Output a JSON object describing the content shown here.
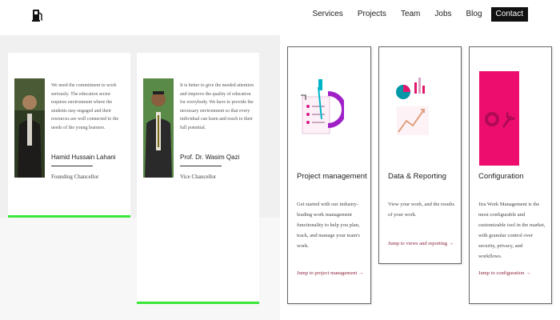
{
  "header": {
    "logo_icon": "fuel-pump-icon",
    "nav": [
      {
        "label": "Services"
      },
      {
        "label": "Projects"
      },
      {
        "label": "Team"
      },
      {
        "label": "Jobs"
      },
      {
        "label": "Blog"
      },
      {
        "label": "Contact"
      }
    ]
  },
  "profiles": [
    {
      "quote": "We need the commitment to work seriously. The education sector requires environment where the students stay engaged and their resources are well connected to the needs of the young learners.",
      "name": "Hamid Hussain Lahani",
      "title": "Founding Chancellor"
    },
    {
      "quote": "It is better to give the needed attention and improve the quality of education for everybody. We have to provide the necessary environment so that every individual can learn and reach to their full potential.",
      "name": "Prof. Dr. Wasim Qazi",
      "title": "Vice Chancellor"
    }
  ],
  "features": [
    {
      "title": "Project management",
      "description": "Get started with our industry-leading work management functionality to help you plan, track, and manage your team's work.",
      "link": "Jump to project management →",
      "icon": "project-management-illustration"
    },
    {
      "title": "Data & Reporting",
      "description": "View your work, and the results of your work.",
      "link": "Jump to views and reporting →",
      "icon": "data-reporting-illustration"
    },
    {
      "title": "Configuration",
      "description": "Jira Work Management is the most configurable and customizable tool in the market, with granular control over security, privacy, and workflows.",
      "link": "Jump to configuration →",
      "icon": "configuration-gear-wrench-illustration"
    }
  ],
  "colors": {
    "accent_green": "#39e639",
    "config_pink": "#ec0d6e",
    "link_color": "#8b1f3a",
    "contact_bg": "#111111"
  }
}
